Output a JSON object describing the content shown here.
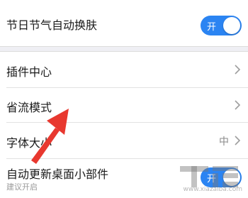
{
  "settings": {
    "festival_skin": {
      "label": "节日节气自动换肤",
      "toggle_text": "开"
    },
    "plugin_center": {
      "label": "插件中心"
    },
    "data_saver": {
      "label": "省流模式"
    },
    "font_size": {
      "label": "字体大小",
      "value": "中"
    },
    "widget_update": {
      "label": "自动更新桌面小部件",
      "subtitle": "建议开启",
      "toggle_text": "开"
    }
  },
  "watermark": {
    "url": "www.xiazaiba.com"
  },
  "colors": {
    "accent": "#2b84f2",
    "annotation_arrow": "#e8382f"
  }
}
